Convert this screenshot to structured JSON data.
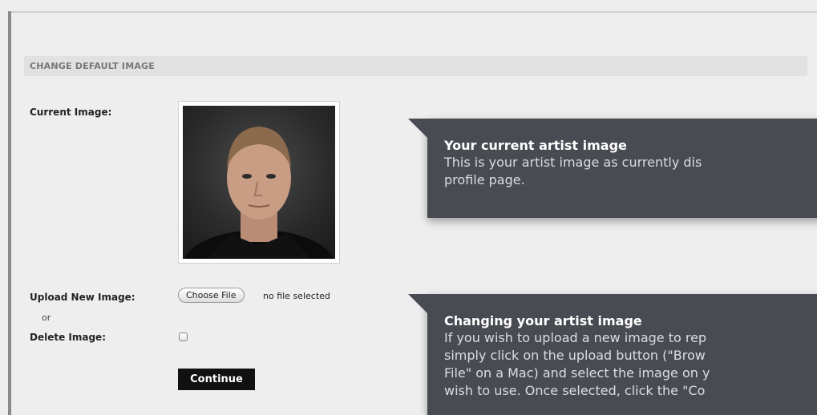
{
  "section": {
    "title": "CHANGE DEFAULT IMAGE"
  },
  "form": {
    "current_image_label": "Current Image:",
    "upload_label": "Upload New Image:",
    "or_label": "or",
    "delete_label": "Delete Image:",
    "choose_file_label": "Choose File",
    "file_status": "no file selected",
    "delete_checked": false,
    "continue_label": "Continue"
  },
  "tooltips": [
    {
      "title": "Your current artist image",
      "body": "This is your artist image as currently dis\nprofile page."
    },
    {
      "title": "Changing your artist image",
      "body": "If you wish to upload a new image to rep\nsimply click on the upload button (\"Brow\nFile\" on a Mac) and select the image on y\nwish to use. Once selected, click the \"Co"
    }
  ],
  "colors": {
    "tooltip_bg": "#494b52",
    "header_bg": "#e1e1e1",
    "page_bg": "#eeeeee"
  }
}
